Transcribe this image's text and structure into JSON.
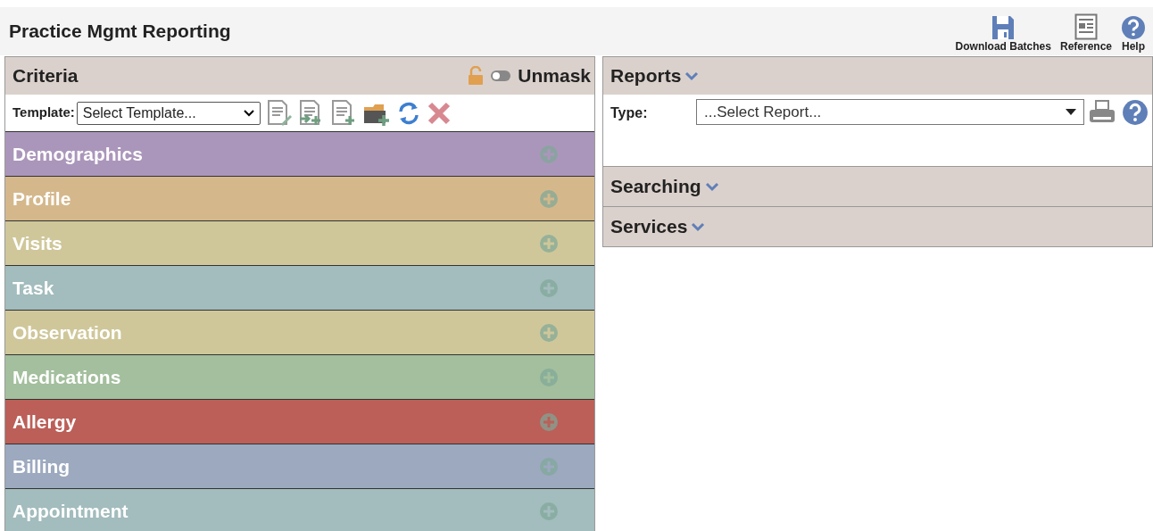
{
  "header": {
    "title": "Practice Mgmt Reporting",
    "actions": [
      {
        "kind": "save",
        "label": "Download Batches"
      },
      {
        "kind": "reference",
        "label": "Reference"
      },
      {
        "kind": "help",
        "label": "Help"
      }
    ]
  },
  "criteria": {
    "title": "Criteria",
    "locked": false,
    "unmask_label": "Unmask",
    "unmask_on": false,
    "template_label": "Template:",
    "template_value": "Select Template...",
    "sections": [
      {
        "label": "Demographics",
        "color": "#ab96bb"
      },
      {
        "label": "Profile",
        "color": "#d4b88c"
      },
      {
        "label": "Visits",
        "color": "#cfc79a"
      },
      {
        "label": "Task",
        "color": "#a3bcbd"
      },
      {
        "label": "Observation",
        "color": "#cfc79a"
      },
      {
        "label": "Medications",
        "color": "#a3bf9d"
      },
      {
        "label": "Allergy",
        "color": "#bb5f58"
      },
      {
        "label": "Billing",
        "color": "#9ca9bf"
      },
      {
        "label": "Appointment",
        "color": "#a3bcbd"
      }
    ]
  },
  "reports": {
    "title": "Reports",
    "expanded": true,
    "type_label": "Type:",
    "type_value": "...Select Report..."
  },
  "panels": [
    {
      "title": "Searching",
      "expanded": false
    },
    {
      "title": "Services",
      "expanded": false
    }
  ]
}
